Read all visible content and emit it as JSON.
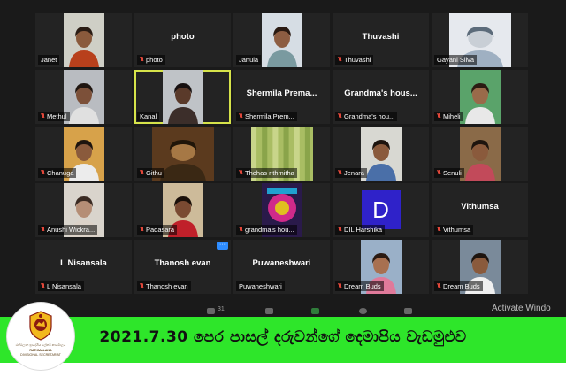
{
  "participants": [
    {
      "name": "Janet",
      "headline": "",
      "muted": false,
      "video": "person",
      "bg": "#cfcfc6",
      "skin": "#8a5a3c",
      "cloth": "#b8401c",
      "hair": "#2a1c14"
    },
    {
      "name": "photo",
      "headline": "photo",
      "muted": true,
      "video": "none"
    },
    {
      "name": "Janula",
      "headline": "",
      "muted": false,
      "video": "person",
      "bg": "#d6dde4",
      "skin": "#8d5d42",
      "cloth": "#7a9aa0",
      "hair": "#2a1a12"
    },
    {
      "name": "Thuvashi",
      "headline": "Thuvashi",
      "muted": true,
      "video": "none"
    },
    {
      "name": "Gayani Silva",
      "headline": "",
      "muted": false,
      "video": "room",
      "bg": "#e6e9ee",
      "skin": "#c9cfd6",
      "cloth": "#9fb0c2",
      "hair": "#5c6b7a"
    },
    {
      "name": "Methul",
      "headline": "",
      "muted": true,
      "video": "person",
      "bg": "#b9bcc1",
      "skin": "#7c5039",
      "cloth": "#e0e0e0",
      "hair": "#1f1510"
    },
    {
      "name": "Kanal",
      "headline": "",
      "muted": false,
      "video": "person",
      "bg": "#bfc3c7",
      "skin": "#5a3a2a",
      "cloth": "#3c2e2a",
      "hair": "#161010",
      "active": true
    },
    {
      "name": "Shermila Prem...",
      "headline": "Shermila Prema...",
      "muted": true,
      "video": "none"
    },
    {
      "name": "Grandma's hou...",
      "headline": "Grandma's hous...",
      "muted": true,
      "video": "none"
    },
    {
      "name": "Miheli",
      "headline": "",
      "muted": true,
      "video": "person",
      "bg": "#5aa36a",
      "skin": "#9a6a4a",
      "cloth": "#e8e8e8",
      "hair": "#2b1b12"
    },
    {
      "name": "Chanuga",
      "headline": "",
      "muted": true,
      "video": "person",
      "bg": "#d7a24a",
      "skin": "#8a5a3c",
      "cloth": "#ececec",
      "hair": "#1d140e"
    },
    {
      "name": "Githu",
      "headline": "",
      "muted": true,
      "video": "room",
      "bg": "#5b3a1e",
      "skin": "#a67845",
      "cloth": "#3a2814",
      "hair": "#1f1509"
    },
    {
      "name": "Thehas rithmitha",
      "headline": "",
      "muted": true,
      "video": "curtain",
      "bg": "#a9bd63",
      "skin": "#c8d58a",
      "cloth": "#8aa44a",
      "hair": "#6b8234"
    },
    {
      "name": "Jenara",
      "headline": "",
      "muted": true,
      "video": "person",
      "bg": "#d8d8d2",
      "skin": "#8a5a3c",
      "cloth": "#4a6fa8",
      "hair": "#1d140e"
    },
    {
      "name": "Senuli",
      "headline": "",
      "muted": true,
      "video": "person",
      "bg": "#8a6a48",
      "skin": "#8a5a3c",
      "cloth": "#c24a5a",
      "hair": "#1d140e"
    },
    {
      "name": "Anushi Wickra...",
      "headline": "",
      "muted": true,
      "video": "person",
      "bg": "#d9d4cc",
      "skin": "#b58e76",
      "cloth": "#dcd2c8",
      "hair": "#3a2a22"
    },
    {
      "name": "Padasara",
      "headline": "",
      "muted": true,
      "video": "person",
      "bg": "#cdbb9a",
      "skin": "#7a4a32",
      "cloth": "#c0202a",
      "hair": "#1a100a"
    },
    {
      "name": "grandma's hou...",
      "headline": "",
      "muted": true,
      "video": "art",
      "bg": "#2a1a4a",
      "skin": "#e0c020",
      "cloth": "#d02a8a",
      "hair": "#20a0d0"
    },
    {
      "name": "DIL Harshika",
      "headline": "",
      "muted": true,
      "video": "letter",
      "letter": "D"
    },
    {
      "name": "Vithumsa",
      "headline": "Vithumsa",
      "muted": true,
      "video": "none"
    },
    {
      "name": "L Nisansala",
      "headline": "L Nisansala",
      "muted": true,
      "video": "none"
    },
    {
      "name": "Thanosh evan",
      "headline": "Thanosh evan",
      "muted": true,
      "video": "none",
      "more": "···"
    },
    {
      "name": "Puwaneshwari",
      "headline": "Puwaneshwari",
      "muted": false,
      "video": "none"
    },
    {
      "name": "Dream Buds",
      "headline": "",
      "muted": true,
      "video": "person",
      "bg": "#9ab0c8",
      "skin": "#a87050",
      "cloth": "#e07a9a",
      "hair": "#2a1a12"
    },
    {
      "name": "Dream Buds",
      "headline": "",
      "muted": true,
      "video": "person",
      "bg": "#7a8a9a",
      "skin": "#8a5a3c",
      "cloth": "#f0f0f0",
      "hair": "#1d140e"
    }
  ],
  "overlay": {
    "activate_text": "Activate Windo",
    "toolbar_count": "31"
  },
  "banner": {
    "title": "2021.7.30 පෙර පාසල් දරුවන්ගේ දෙමාපිය වැඩමුළුව",
    "color": "#2ee62a"
  },
  "logo": {
    "line1": "රත්මලාන ප්‍රාදේශීය ලේකම් කාර්යාලය",
    "line2": "RATHMALANA",
    "line3": "DIVISIONAL SECRETARIAT"
  }
}
